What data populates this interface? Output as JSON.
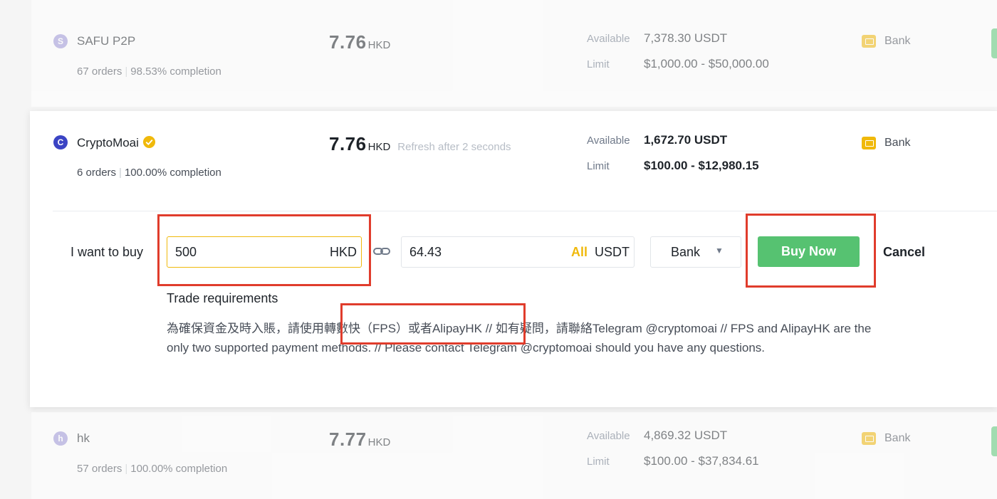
{
  "listings": [
    {
      "avatar_letter": "S",
      "avatar_color": "#9f98d8",
      "name": "SAFU P2P",
      "verified": false,
      "orders": "67 orders",
      "completion": "98.53% completion",
      "price": "7.76",
      "currency": "HKD",
      "refresh": "",
      "available_label": "Available",
      "available": "7,378.30 USDT",
      "limit_label": "Limit",
      "limit": "$1,000.00 - $50,000.00",
      "payment": "Bank"
    },
    {
      "avatar_letter": "C",
      "avatar_color": "#3b44c4",
      "name": "CryptoMoai",
      "verified": true,
      "orders": "6 orders",
      "completion": "100.00% completion",
      "price": "7.76",
      "currency": "HKD",
      "refresh": "Refresh after 2 seconds",
      "available_label": "Available",
      "available": "1,672.70 USDT",
      "limit_label": "Limit",
      "limit": "$100.00 - $12,980.15",
      "payment": "Bank"
    },
    {
      "avatar_letter": "h",
      "avatar_color": "#9f98d8",
      "name": "hk",
      "verified": false,
      "orders": "57 orders",
      "completion": "100.00% completion",
      "price": "7.77",
      "currency": "HKD",
      "refresh": "",
      "available_label": "Available",
      "available": "4,869.32 USDT",
      "limit_label": "Limit",
      "limit": "$100.00 - $37,834.61",
      "payment": "Bank"
    }
  ],
  "buy_form": {
    "label": "I want to buy",
    "fiat_amount": "500",
    "fiat_currency": "HKD",
    "crypto_amount": "64.43",
    "all_label": "All",
    "crypto_currency": "USDT",
    "payment_method": "Bank",
    "buy_button": "Buy Now",
    "cancel": "Cancel"
  },
  "trade_requirements": {
    "title": "Trade requirements",
    "text": "為確保資金及時入賬，請使用轉數快（FPS）或者AlipayHK // 如有疑問，請聯絡Telegram @cryptomoai // FPS and AlipayHK are the only two supported payment methods. // Please contact Telegram @cryptomoai should you have any questions."
  },
  "colors": {
    "accent": "#f0b90b",
    "buy": "#56c271",
    "highlight": "#e03c2c"
  }
}
